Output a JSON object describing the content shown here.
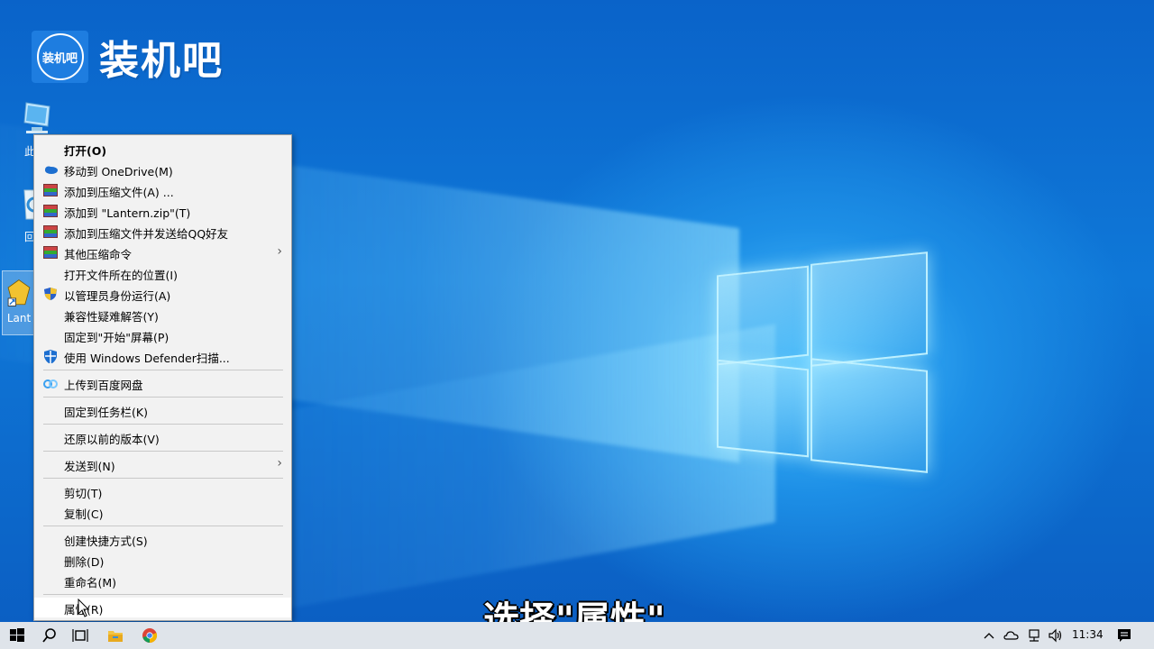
{
  "brand": {
    "logo_text": "装机吧",
    "title": "装机吧"
  },
  "desktop": {
    "icons": [
      {
        "label": "此电",
        "icon": "computer-icon"
      },
      {
        "label": "回收",
        "icon": "recycle-bin-icon"
      },
      {
        "label": "Lant",
        "icon": "lantern-shortcut-icon"
      }
    ]
  },
  "context_menu": {
    "items": [
      {
        "label": "打开(O)",
        "icon": "",
        "bold": true
      },
      {
        "label": "移动到 OneDrive(M)",
        "icon": "onedrive-icon"
      },
      {
        "label": "添加到压缩文件(A) ...",
        "icon": "winrar-icon"
      },
      {
        "label": "添加到 \"Lantern.zip\"(T)",
        "icon": "winrar-icon"
      },
      {
        "label": "添加到压缩文件并发送给QQ好友",
        "icon": "winrar-icon"
      },
      {
        "label": "其他压缩命令",
        "icon": "winrar-icon",
        "submenu": true
      },
      {
        "label": "打开文件所在的位置(I)",
        "icon": ""
      },
      {
        "label": "以管理员身份运行(A)",
        "icon": "uac-shield-icon"
      },
      {
        "label": "兼容性疑难解答(Y)",
        "icon": ""
      },
      {
        "label": "固定到\"开始\"屏幕(P)",
        "icon": ""
      },
      {
        "label": "使用 Windows Defender扫描...",
        "icon": "defender-icon"
      },
      {
        "label": "上传到百度网盘",
        "icon": "baidu-netdisk-icon"
      },
      {
        "label": "固定到任务栏(K)",
        "icon": ""
      },
      {
        "label": "还原以前的版本(V)",
        "icon": ""
      },
      {
        "label": "发送到(N)",
        "icon": "",
        "submenu": true
      },
      {
        "label": "剪切(T)",
        "icon": ""
      },
      {
        "label": "复制(C)",
        "icon": ""
      },
      {
        "label": "创建快捷方式(S)",
        "icon": ""
      },
      {
        "label": "删除(D)",
        "icon": ""
      },
      {
        "label": "重命名(M)",
        "icon": ""
      },
      {
        "label": "属性(R)",
        "icon": "",
        "highlighted": true
      }
    ]
  },
  "subtitle": "选择\"属性\"",
  "taskbar": {
    "icons": [
      "windows-start-icon",
      "search-icon",
      "task-view-icon",
      "file-explorer-icon",
      "chrome-icon"
    ],
    "tray_icons": [
      "chevron-up-icon",
      "onedrive-icon",
      "network-icon",
      "volume-icon"
    ],
    "clock": "11:34",
    "notification_icon": "notification-icon"
  }
}
